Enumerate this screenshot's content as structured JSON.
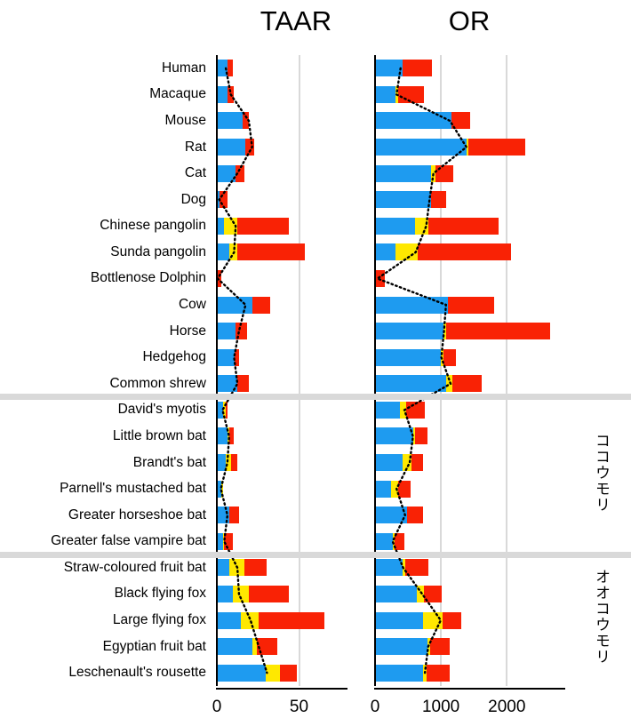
{
  "panels": [
    {
      "key": "taar",
      "title": "TAAR"
    },
    {
      "key": "or",
      "title": "OR"
    }
  ],
  "group_labels": {
    "microbats": "ココウモリ",
    "megabats": "オオコウモリ"
  },
  "colors": {
    "intact": "#1e9bf0",
    "partial": "#ffe800",
    "pseudo": "#f92205",
    "gridline": "#d9d9d9",
    "axis": "#000000",
    "trend": "#000000",
    "separator": "#d9d9d9",
    "background": "#ffffff"
  },
  "chart_data": {
    "type": "bar",
    "orientation": "horizontal",
    "stacked": true,
    "title": "",
    "grid": true,
    "legend_position": "none",
    "categories": [
      "Human",
      "Macaque",
      "Mouse",
      "Rat",
      "Cat",
      "Dog",
      "Chinese pangolin",
      "Sunda pangolin",
      "Bottlenose Dolphin",
      "Cow",
      "Horse",
      "Hedgehog",
      "Common shrew",
      "David's myotis",
      "Little  brown bat",
      "Brandt's bat",
      "Parnell's mustached bat",
      "Greater horseshoe bat",
      "Greater false vampire bat",
      "Straw-coloured fruit bat",
      "Black flying fox",
      "Large flying fox",
      "Egyptian fruit bat",
      "Leschenault's rousette"
    ],
    "group_breaks_after": [
      "Common shrew",
      "Greater false vampire bat"
    ],
    "panels": [
      {
        "name": "TAAR",
        "xlabel": "",
        "xlim": [
          0,
          80
        ],
        "xticks": [
          0,
          50
        ],
        "xticklabels": [
          "0",
          "50"
        ],
        "gridlines": [
          50
        ],
        "series": [
          {
            "name": "intact",
            "values": [
              6,
              6,
              15,
              17,
              11,
              1,
              4,
              7,
              0,
              21,
              11,
              10,
              12,
              3,
              6,
              5,
              2,
              7,
              3,
              7,
              9,
              14,
              21,
              29
            ]
          },
          {
            "name": "partial",
            "values": [
              0,
              0,
              0,
              0,
              0,
              0,
              8,
              5,
              0,
              0,
              0,
              0,
              0,
              2,
              1,
              3,
              1,
              0,
              1,
              9,
              10,
              11,
              3,
              9
            ]
          },
          {
            "name": "pseudo",
            "values": [
              3,
              4,
              4,
              5,
              5,
              5,
              31,
              41,
              2,
              11,
              7,
              3,
              7,
              1,
              3,
              4,
              0,
              6,
              5,
              14,
              24,
              40,
              12,
              10
            ]
          }
        ],
        "trend_values": [
          6,
          9,
          20,
          22,
          13,
          2,
          12,
          11,
          1,
          18,
          14,
          11,
          13,
          4,
          8,
          7,
          3,
          7,
          5,
          13,
          14,
          21,
          26,
          31
        ]
      },
      {
        "name": "OR",
        "xlabel": "",
        "xlim": [
          0,
          2900
        ],
        "xticks": [
          0,
          1000,
          2000
        ],
        "xticklabels": [
          "0",
          "1000",
          "2000"
        ],
        "gridlines": [
          1000,
          2000
        ],
        "series": [
          {
            "name": "intact",
            "values": [
              400,
              300,
              1150,
              1370,
              840,
              840,
              600,
              300,
              0,
              1090,
              1030,
              980,
              1060,
              370,
              560,
              410,
              230,
              470,
              250,
              400,
              620,
              720,
              780,
              720
            ]
          },
          {
            "name": "partial",
            "values": [
              0,
              40,
              0,
              30,
              60,
              0,
              190,
              330,
              0,
              0,
              30,
              40,
              100,
              90,
              30,
              130,
              110,
              0,
              30,
              40,
              110,
              290,
              40,
              50
            ]
          },
          {
            "name": "pseudo",
            "values": [
              450,
              390,
              280,
              870,
              280,
              230,
              1070,
              1420,
              130,
              700,
              1590,
              200,
              440,
              280,
              190,
              170,
              180,
              240,
              150,
              360,
              270,
              280,
              300,
              350
            ]
          },
          {
            "name": "total_marker",
            "values": [
              850,
              730,
              1430,
              2270,
              1180,
              1070,
              1860,
              2050,
              130,
              1790,
              2650,
              1220,
              1600,
              740,
              780,
              710,
              520,
              710,
              430,
              800,
              1000,
              1290,
              1120,
              1120
            ]
          }
        ],
        "trend_values": [
          400,
          340,
          1150,
          1400,
          900,
          840,
          790,
          630,
          50,
          1090,
          1060,
          1020,
          1160,
          460,
          590,
          540,
          340,
          470,
          280,
          440,
          730,
          1010,
          820,
          770
        ]
      }
    ]
  },
  "axis_labels": {
    "taar_ticks": [
      "0",
      "50"
    ],
    "or_ticks": [
      "0",
      "1000",
      "2000"
    ]
  }
}
